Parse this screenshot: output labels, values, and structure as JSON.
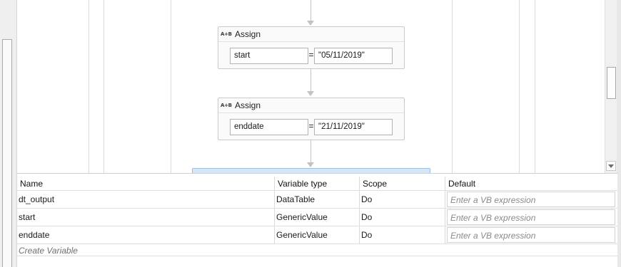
{
  "activities": [
    {
      "icon": "A+B",
      "title": "Assign",
      "to": "start",
      "operator": "=",
      "value": "\"05/11/2019\""
    },
    {
      "icon": "A+B",
      "title": "Assign",
      "to": "enddate",
      "operator": "=",
      "value": "\"21/11/2019\""
    }
  ],
  "variables": {
    "headers": {
      "name": "Name",
      "type": "Variable type",
      "scope": "Scope",
      "default": "Default"
    },
    "rows": [
      {
        "name": "dt_output",
        "type": "DataTable",
        "scope": "Do",
        "default_placeholder": "Enter a VB expression"
      },
      {
        "name": "start",
        "type": "GenericValue",
        "scope": "Do",
        "default_placeholder": "Enter a VB expression"
      },
      {
        "name": "enddate",
        "type": "GenericValue",
        "scope": "Do",
        "default_placeholder": "Enter a VB expression"
      }
    ],
    "create_label": "Create Variable"
  }
}
